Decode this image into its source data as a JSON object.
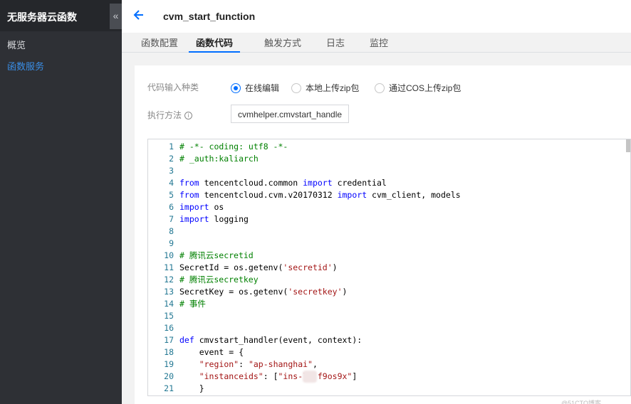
{
  "sidebar": {
    "title": "无服务器云函数",
    "collapse_icon": "«",
    "items": [
      {
        "label": "概览"
      },
      {
        "label": "函数服务"
      }
    ]
  },
  "header": {
    "back_icon": "back-arrow-icon",
    "function_name": "cvm_start_function"
  },
  "tabs": [
    {
      "label": "函数配置",
      "active": false
    },
    {
      "label": "函数代码",
      "active": true
    },
    {
      "label": "触发方式",
      "active": false
    },
    {
      "label": "日志",
      "active": false
    },
    {
      "label": "监控",
      "active": false
    }
  ],
  "form": {
    "code_input_label": "代码输入种类",
    "options": [
      {
        "label": "在线编辑",
        "selected": true
      },
      {
        "label": "本地上传zip包",
        "selected": false
      },
      {
        "label": "通过COS上传zip包",
        "selected": false
      }
    ],
    "handler_label": "执行方法",
    "info_icon": "i",
    "handler_value": "cvmhelper.cmvstart_handle"
  },
  "colors": {
    "accent": "#006eff",
    "comment": "#008000",
    "keyword": "#0000ff",
    "string": "#a31515",
    "line_number": "#237893"
  },
  "code": {
    "lines": [
      [
        {
          "t": "# -*- coding: utf8 -*-",
          "c": "comment"
        }
      ],
      [
        {
          "t": "# _auth:kaliarch",
          "c": "comment"
        }
      ],
      [],
      [
        {
          "t": "from",
          "c": "keyword"
        },
        {
          "t": " tencentcloud.common ",
          "c": "plain"
        },
        {
          "t": "import",
          "c": "keyword"
        },
        {
          "t": " credential",
          "c": "plain"
        }
      ],
      [
        {
          "t": "from",
          "c": "keyword"
        },
        {
          "t": " tencentcloud.cvm.v20170312 ",
          "c": "plain"
        },
        {
          "t": "import",
          "c": "keyword"
        },
        {
          "t": " cvm_client, models",
          "c": "plain"
        }
      ],
      [
        {
          "t": "import",
          "c": "keyword"
        },
        {
          "t": " os",
          "c": "plain"
        }
      ],
      [
        {
          "t": "import",
          "c": "keyword"
        },
        {
          "t": " logging",
          "c": "plain"
        }
      ],
      [],
      [],
      [
        {
          "t": "# 腾讯云secretid",
          "c": "comment"
        }
      ],
      [
        {
          "t": "SecretId = os.getenv(",
          "c": "plain"
        },
        {
          "t": "'secretid'",
          "c": "string"
        },
        {
          "t": ")",
          "c": "plain"
        }
      ],
      [
        {
          "t": "# 腾讯云secretkey",
          "c": "comment"
        }
      ],
      [
        {
          "t": "SecretKey = os.getenv(",
          "c": "plain"
        },
        {
          "t": "'secretkey'",
          "c": "string"
        },
        {
          "t": ")",
          "c": "plain"
        }
      ],
      [
        {
          "t": "# 事件",
          "c": "comment"
        }
      ],
      [],
      [],
      [
        {
          "t": "def",
          "c": "keyword"
        },
        {
          "t": " cmvstart_handler(event, context):",
          "c": "plain"
        }
      ],
      [
        {
          "t": "    event = {",
          "c": "plain"
        }
      ],
      [
        {
          "t": "    ",
          "c": "plain"
        },
        {
          "t": "\"region\"",
          "c": "string"
        },
        {
          "t": ": ",
          "c": "plain"
        },
        {
          "t": "\"ap-shanghai\"",
          "c": "string"
        },
        {
          "t": ",",
          "c": "plain"
        }
      ],
      [
        {
          "t": "    ",
          "c": "plain"
        },
        {
          "t": "\"instanceids\"",
          "c": "string"
        },
        {
          "t": ": [",
          "c": "plain"
        },
        {
          "t": "\"ins-l  f9os9x\"",
          "c": "string"
        },
        {
          "t": "]",
          "c": "plain"
        }
      ],
      [
        {
          "t": "    }",
          "c": "plain"
        }
      ]
    ]
  },
  "watermark": "@51CTO博客"
}
